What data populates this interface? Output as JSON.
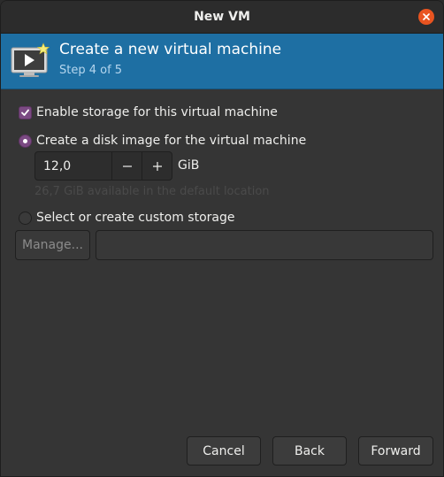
{
  "window": {
    "title": "New VM"
  },
  "banner": {
    "title": "Create a new virtual machine",
    "step": "Step 4 of 5",
    "icon": "vm-monitor-icon"
  },
  "storage": {
    "enable_label": "Enable storage for this virtual machine",
    "enable_checked": true,
    "create_disk_label": "Create a disk image for the virtual machine",
    "create_disk_selected": true,
    "disk_size_value": "12,0",
    "disk_size_unit": "GiB",
    "available_text": "26,7 GiB available in the default location",
    "custom_label": "Select or create custom storage",
    "custom_selected": false,
    "manage_label": "Manage...",
    "custom_path_value": ""
  },
  "footer": {
    "cancel_label": "Cancel",
    "back_label": "Back",
    "forward_label": "Forward"
  },
  "colors": {
    "accent_banner": "#1e6fa3",
    "check_accent": "#7b4a83",
    "close_button": "#e95420"
  }
}
